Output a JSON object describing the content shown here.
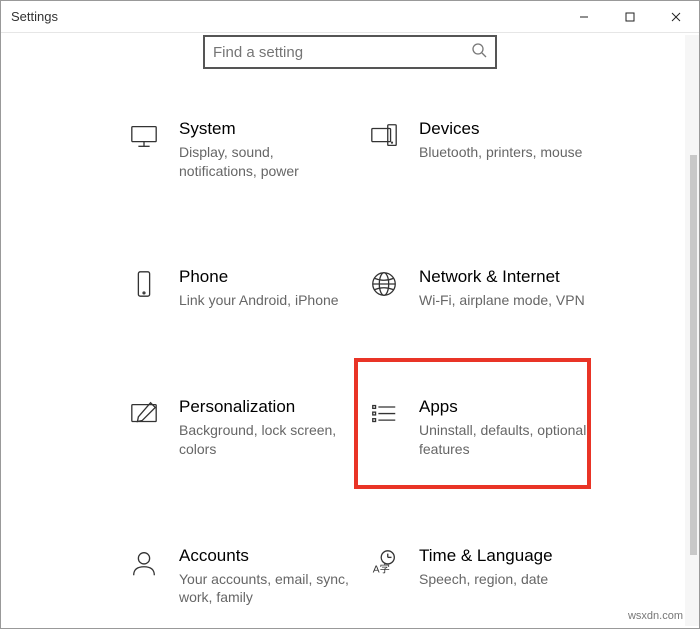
{
  "window": {
    "title": "Settings"
  },
  "search": {
    "placeholder": "Find a setting"
  },
  "categories": {
    "system": {
      "title": "System",
      "desc": "Display, sound, notifications, power"
    },
    "devices": {
      "title": "Devices",
      "desc": "Bluetooth, printers, mouse"
    },
    "phone": {
      "title": "Phone",
      "desc": "Link your Android, iPhone"
    },
    "network": {
      "title": "Network & Internet",
      "desc": "Wi-Fi, airplane mode, VPN"
    },
    "personalization": {
      "title": "Personalization",
      "desc": "Background, lock screen, colors"
    },
    "apps": {
      "title": "Apps",
      "desc": "Uninstall, defaults, optional features"
    },
    "accounts": {
      "title": "Accounts",
      "desc": "Your accounts, email, sync, work, family"
    },
    "time": {
      "title": "Time & Language",
      "desc": "Speech, region, date"
    }
  },
  "watermark": "wsxdn.com"
}
